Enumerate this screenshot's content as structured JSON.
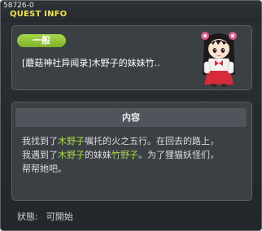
{
  "window": {
    "id": "58726-0",
    "title": "QUEST INFO"
  },
  "quest": {
    "category": "一般",
    "name": "[蘑菇神社异闻录]木野子的妹妹竹.."
  },
  "section": {
    "header": "内容",
    "desc": {
      "l1_a": "我找到了",
      "l1_hl": "木野子",
      "l1_b": "嘱托的火之五行。在回去的路上，",
      "l2_a": "我遇到了",
      "l2_hl1": "木野子",
      "l2_b": "的妹妹",
      "l2_hl2": "竹野子",
      "l2_c": "。为了狸猫妖怪们，",
      "l3": "帮帮她吧。"
    }
  },
  "status": {
    "label": "狀態:",
    "value": "可開始"
  },
  "colors": {
    "accent_title": "#f2e24a",
    "highlight": "#a9d945",
    "tag_green": "#8cc234"
  }
}
